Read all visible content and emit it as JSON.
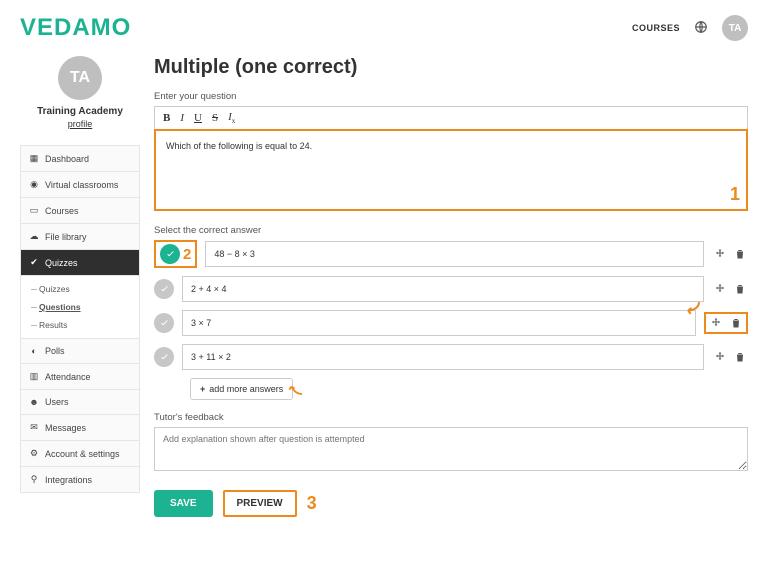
{
  "header": {
    "logo": "VEDAMO",
    "courses_link": "COURSES",
    "avatar_initials": "TA"
  },
  "profile": {
    "avatar_initials": "TA",
    "org_name": "Training Academy",
    "profile_link": "profile"
  },
  "sidebar": {
    "items": [
      {
        "icon": "grid",
        "label": "Dashboard",
        "name": "dashboard"
      },
      {
        "icon": "play",
        "label": "Virtual classrooms",
        "name": "virtual-classrooms"
      },
      {
        "icon": "book",
        "label": "Courses",
        "name": "courses"
      },
      {
        "icon": "cloud",
        "label": "File library",
        "name": "file-library"
      },
      {
        "icon": "check",
        "label": "Quizzes",
        "name": "quizzes",
        "active": true
      },
      {
        "icon": "chart",
        "label": "Polls",
        "name": "polls"
      },
      {
        "icon": "cal",
        "label": "Attendance",
        "name": "attendance"
      },
      {
        "icon": "users",
        "label": "Users",
        "name": "users"
      },
      {
        "icon": "mail",
        "label": "Messages",
        "name": "messages"
      },
      {
        "icon": "gear",
        "label": "Account & settings",
        "name": "account-settings"
      },
      {
        "icon": "plug",
        "label": "Integrations",
        "name": "integrations"
      }
    ],
    "quizzes_sub": [
      {
        "label": "Quizzes",
        "name": "quizzes-sub"
      },
      {
        "label": "Questions",
        "name": "questions-sub",
        "active": true
      },
      {
        "label": "Results",
        "name": "results-sub"
      }
    ]
  },
  "page": {
    "title": "Multiple (one correct)",
    "question_label": "Enter your question",
    "question_text": "Which of the following is equal to 24.",
    "answer_label": "Select the correct answer",
    "answers": [
      {
        "text": "48 − 8 × 3",
        "correct": true
      },
      {
        "text": "2 + 4 × 4",
        "correct": false
      },
      {
        "text": "3 × 7",
        "correct": false
      },
      {
        "text": "3 + 11 × 2",
        "correct": false
      }
    ],
    "add_more": "add more answers",
    "feedback_label": "Tutor's feedback",
    "feedback_placeholder": "Add explanation shown after question is attempted",
    "save_btn": "SAVE",
    "preview_btn": "PREVIEW"
  },
  "annotations": {
    "a1": "1",
    "a2": "2",
    "a3": "3"
  }
}
